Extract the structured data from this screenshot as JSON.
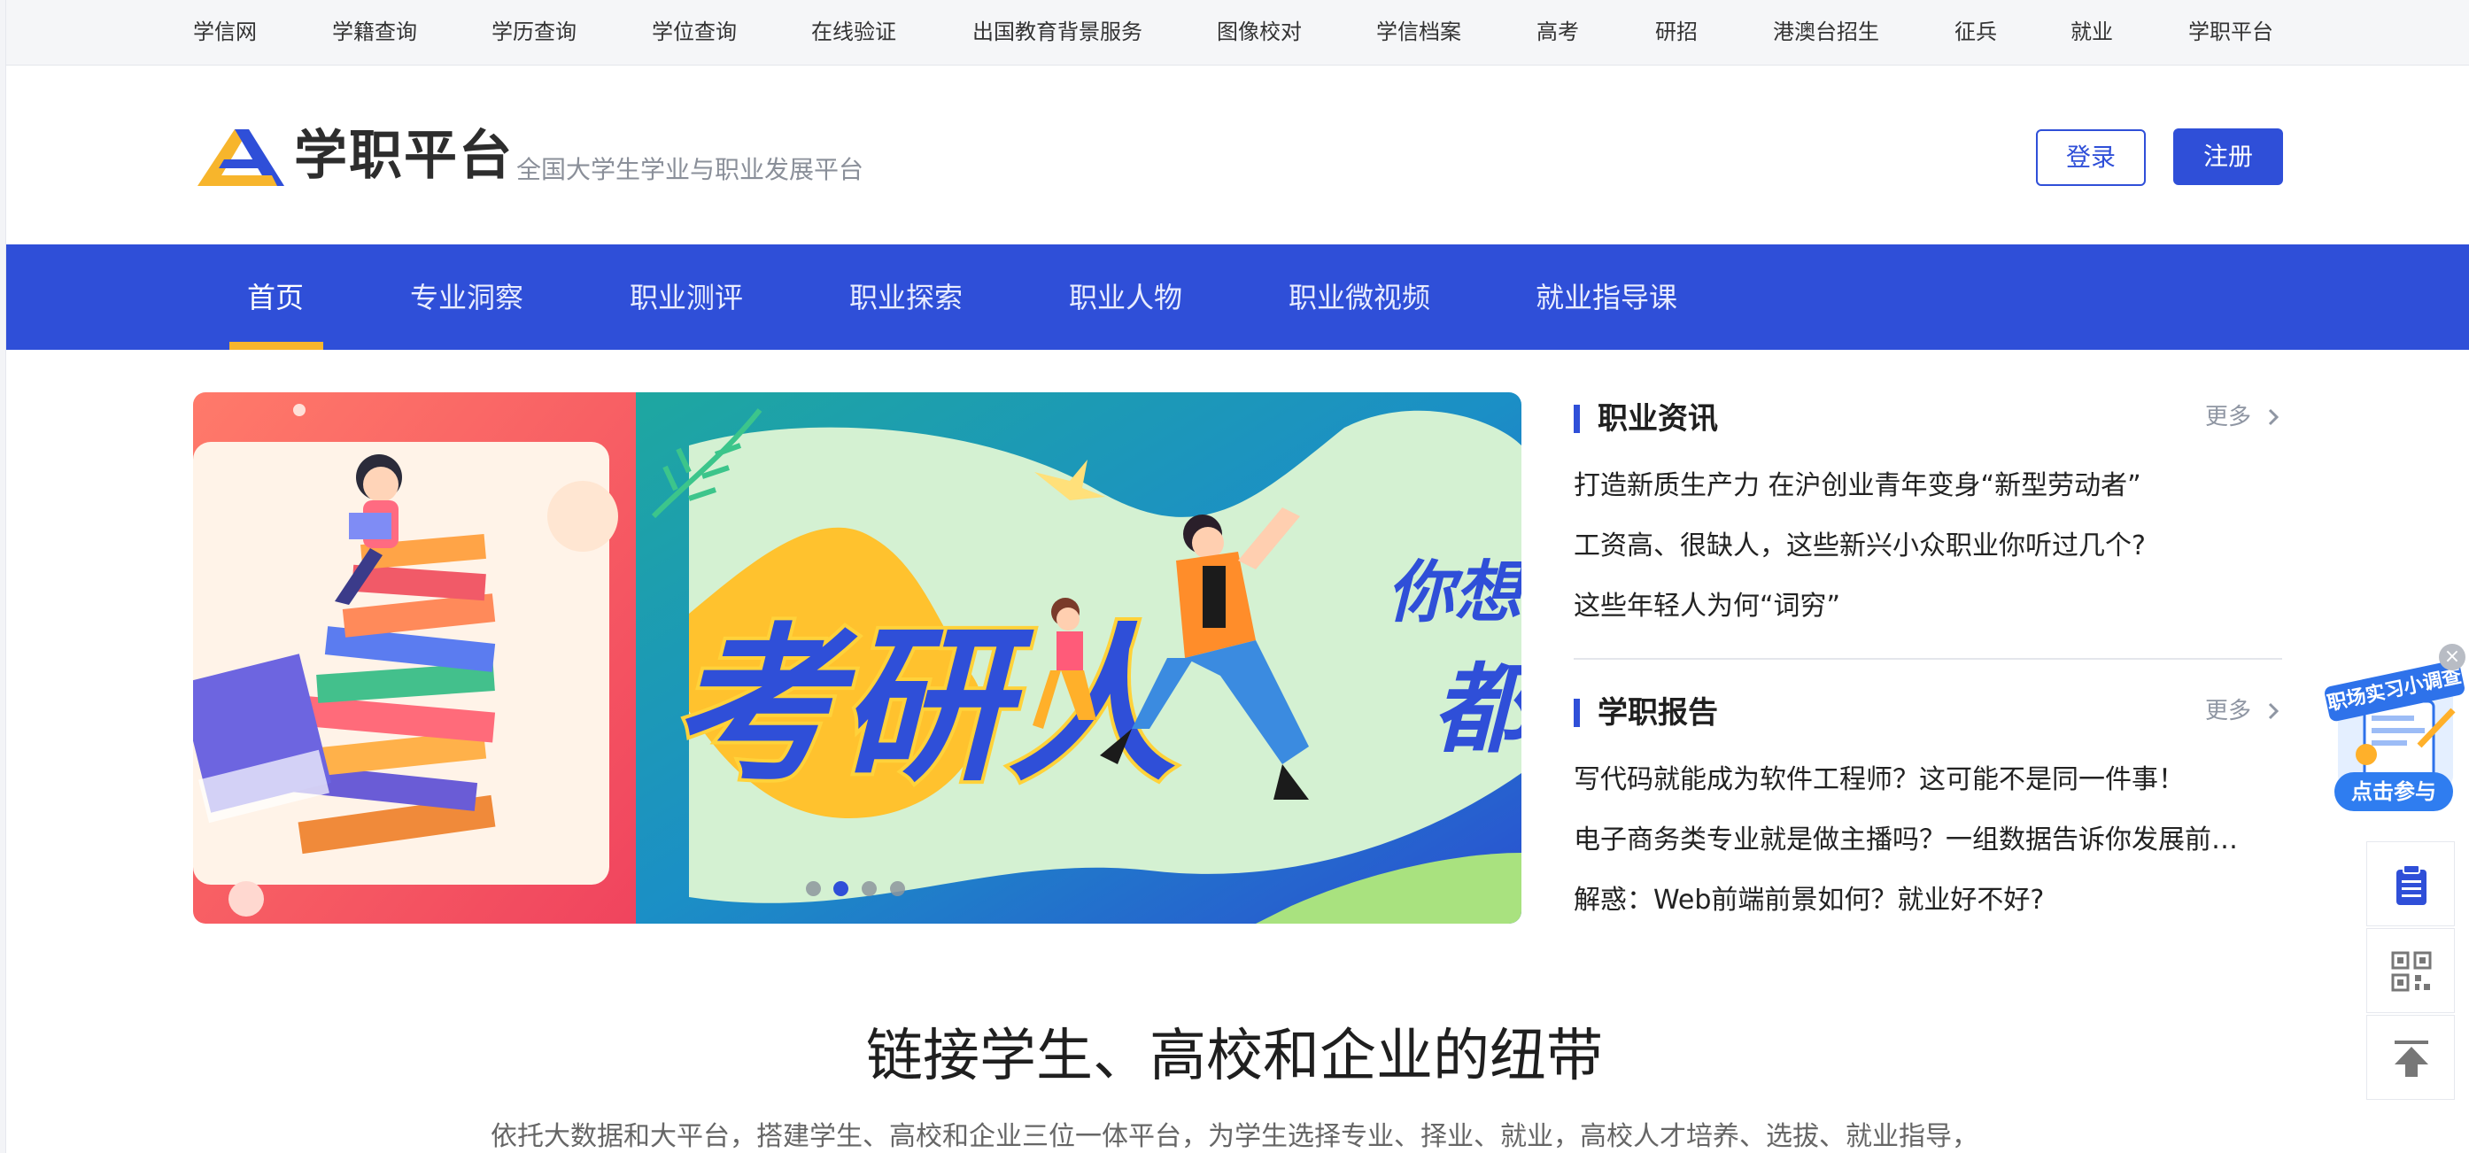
{
  "topbar": {
    "items": [
      "学信网",
      "学籍查询",
      "学历查询",
      "学位查询",
      "在线验证",
      "出国教育背景服务",
      "图像校对",
      "学信档案",
      "高考",
      "研招",
      "港澳台招生",
      "征兵",
      "就业",
      "学职平台"
    ]
  },
  "header": {
    "logo_text": "学职平台",
    "logo_subtitle": "全国大学生学业与职业发展平台",
    "login_label": "登录",
    "register_label": "注册",
    "brand_color": "#2f4fd8",
    "logo_colors": [
      "#f7b52c",
      "#2f4fd8"
    ]
  },
  "nav": {
    "items": [
      "首页",
      "专业洞察",
      "职业测评",
      "职业探索",
      "职业人物",
      "职业微视频",
      "就业指导课"
    ],
    "active_index": 0,
    "active_underline_color": "#f7b52c"
  },
  "banner": {
    "headline": "考研人",
    "side_text_1": "你想了",
    "side_text_2": "都",
    "slide_count": 4,
    "active_slide": 1
  },
  "news": {
    "career": {
      "title": "职业资讯",
      "more": "更多",
      "items": [
        "打造新质生产力 在沪创业青年变身“新型劳动者”",
        "工资高、很缺人，这些新兴小众职业你听过几个?",
        "这些年轻人为何“词穷”"
      ]
    },
    "report": {
      "title": "学职报告",
      "more": "更多",
      "items": [
        "写代码就能成为软件工程师？这可能不是同一件事！",
        "电子商务类专业就是做主播吗？一组数据告诉你发展前…",
        "解惑：Web前端前景如何？就业好不好?"
      ]
    }
  },
  "slogan": {
    "title": "链接学生、高校和企业的纽带",
    "subtitle": "依托大数据和大平台，搭建学生、高校和企业三位一体平台，为学生选择专业、择业、就业，高校人才培养、选拔、就业指导，"
  },
  "float": {
    "promo_ribbon": "职场实习小调查",
    "promo_button": "点击参与",
    "close_icon": "close-icon",
    "tools": [
      "clipboard-icon",
      "qrcode-icon",
      "back-to-top-icon"
    ]
  }
}
